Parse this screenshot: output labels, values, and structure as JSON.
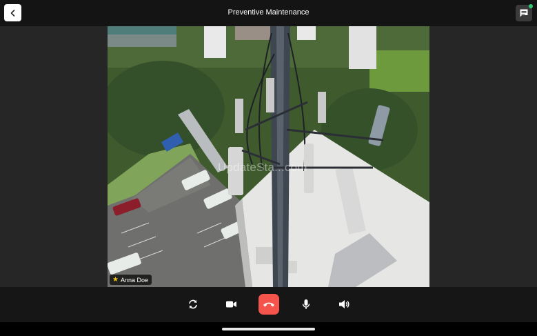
{
  "header": {
    "title": "Preventive Maintenance",
    "back_icon": "chevron-left-icon",
    "chat_icon": "chat-icon",
    "chat_badge_color": "#2ecc71"
  },
  "video": {
    "participant_name": "Anna Doe",
    "host_icon": "star-icon",
    "watermark": "UpdateSta...com"
  },
  "controls": {
    "items": [
      {
        "name": "switch-camera",
        "icon": "rotate-icon"
      },
      {
        "name": "camera",
        "icon": "video-camera-icon"
      },
      {
        "name": "end-call",
        "icon": "phone-hangup-icon",
        "color": "#f4544c"
      },
      {
        "name": "microphone",
        "icon": "microphone-icon"
      },
      {
        "name": "speaker",
        "icon": "speaker-icon"
      }
    ]
  }
}
